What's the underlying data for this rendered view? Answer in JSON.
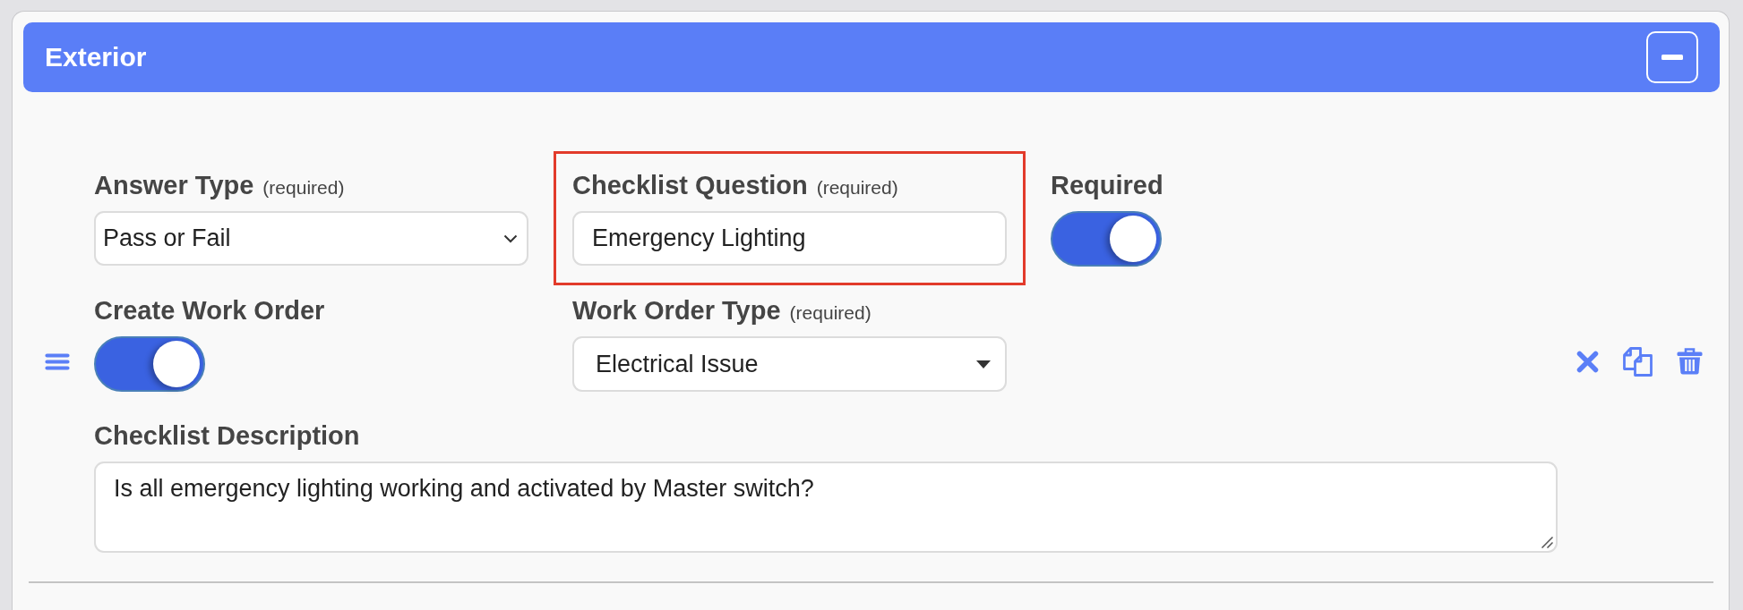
{
  "section": {
    "title": "Exterior",
    "expanded": true
  },
  "fields": [
    {
      "kind": "select",
      "label": "Answer Type",
      "note": "(required)",
      "value": "Pass or Fail"
    },
    {
      "kind": "text",
      "label": "Checklist Question",
      "note": "(required)",
      "value": "Emergency Lighting",
      "highlighted": true
    },
    {
      "kind": "toggle",
      "label": "Required",
      "on": true
    },
    {
      "kind": "toggle",
      "label": "Create Work Order",
      "on": true
    },
    {
      "kind": "dropdown",
      "label": "Work Order Type",
      "note": "(required)",
      "value": "Electrical Issue"
    },
    {
      "kind": "textarea",
      "label": "Checklist Description",
      "value": "Is all emergency lighting working and activated by Master switch?"
    }
  ]
}
